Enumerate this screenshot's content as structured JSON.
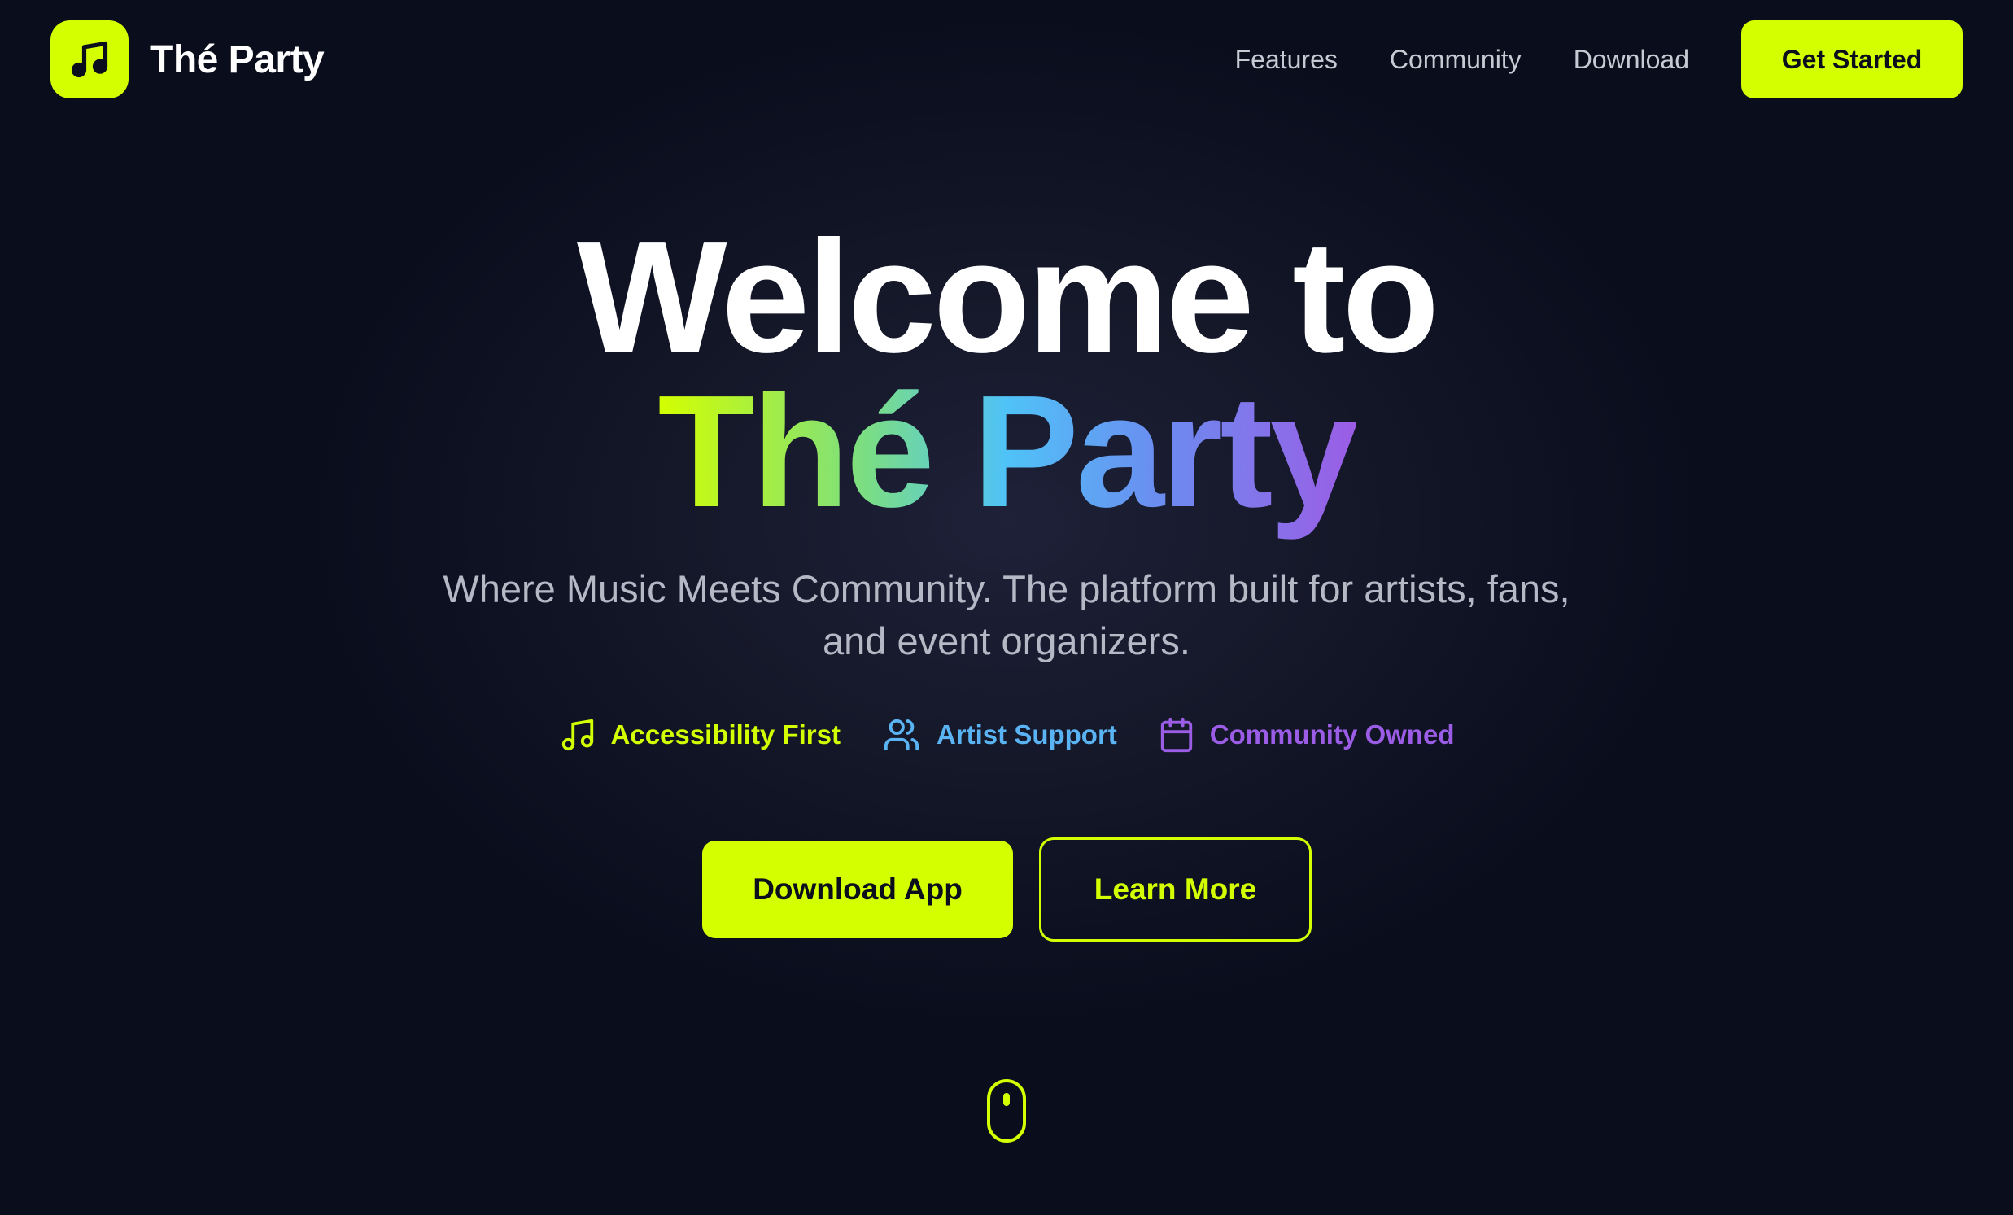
{
  "brand": {
    "name": "Thé Party",
    "logo_icon": "music-note-icon",
    "accent_color": "#d4ff00"
  },
  "nav": {
    "links": [
      "Features",
      "Community",
      "Download"
    ],
    "cta_label": "Get Started"
  },
  "hero": {
    "title_line1": "Welcome to",
    "title_line2": "Thé Party",
    "subtitle": "Where Music Meets Community. The platform built for artists, fans, and event organizers.",
    "gradient_colors": [
      "#d4ff00",
      "#4fc3f7",
      "#9b5de5"
    ]
  },
  "features": [
    {
      "icon": "music-note-icon",
      "label": "Accessibility First",
      "color": "#d4ff00"
    },
    {
      "icon": "users-icon",
      "label": "Artist Support",
      "color": "#5ab4f4"
    },
    {
      "icon": "calendar-icon",
      "label": "Community Owned",
      "color": "#9b5de5"
    }
  ],
  "cta": {
    "primary_label": "Download App",
    "secondary_label": "Learn More"
  },
  "scroll_indicator": {
    "icon": "mouse-scroll-icon"
  }
}
